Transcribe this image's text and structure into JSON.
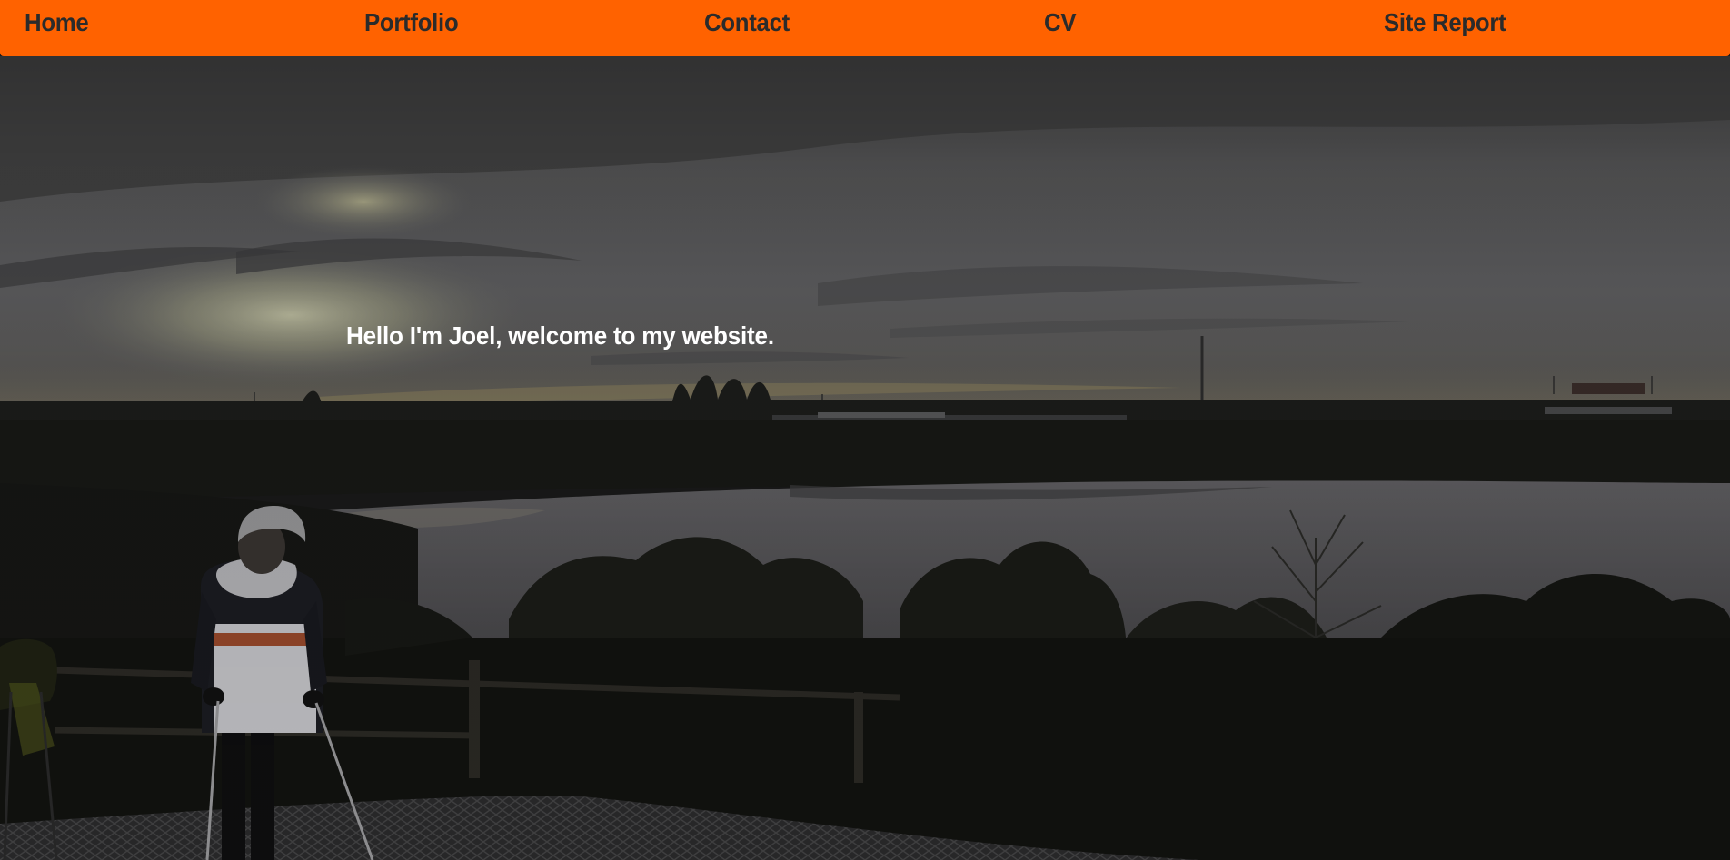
{
  "nav": {
    "items": [
      {
        "label": "Home"
      },
      {
        "label": "Portfolio"
      },
      {
        "label": "Contact"
      },
      {
        "label": "CV"
      },
      {
        "label": "Site Report"
      }
    ]
  },
  "hero": {
    "heading": "Hello I'm Joel, welcome to my website."
  },
  "colors": {
    "nav_background": "#ff6200",
    "nav_text": "#2b2b2b",
    "heading_text": "#ffffff"
  }
}
